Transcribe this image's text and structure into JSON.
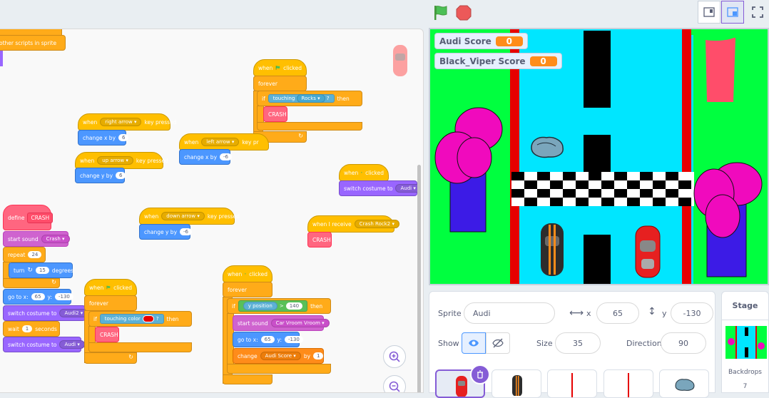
{
  "toolbar": {
    "green_flag_icon": "green-flag-icon",
    "stop_icon": "stop-icon",
    "small_stage_icon": "small-stage-icon",
    "normal_stage_icon": "normal-stage-icon",
    "fullscreen_icon": "fullscreen-icon"
  },
  "code": {
    "top_block": "other scripts in sprite",
    "s1": {
      "hat": "when",
      "hat2": "clicked",
      "forever": "forever",
      "if": "if",
      "touching": "touching",
      "target": "Rocks",
      "q": "?",
      "then": "then",
      "call": "CRASH"
    },
    "s2": {
      "hat": "when",
      "key": "right arrow",
      "pressed": "key pressed",
      "action": "change x by",
      "val": "6"
    },
    "s3": {
      "hat": "when",
      "key": "up arrow",
      "pressed": "key pressed",
      "action": "change y by",
      "val": "6"
    },
    "s4": {
      "hat": "when",
      "key": "left arrow",
      "pressed": "key pr",
      "action": "change x by",
      "val": "-6"
    },
    "s5": {
      "hat": "when",
      "hat2": "clicked",
      "action": "switch costume to",
      "val": "Audi"
    },
    "s6": {
      "hat": "when",
      "key": "down arrow",
      "pressed": "key pressed",
      "action": "change y by",
      "val": "-6"
    },
    "s7": {
      "hat": "when I receive",
      "msg": "Crash Rock2",
      "call": "CRASH"
    },
    "s8": {
      "define": "define",
      "name": "CRASH",
      "sound": "start sound",
      "sound_val": "Crash",
      "repeat": "repeat",
      "repeat_val": "24",
      "turn": "turn",
      "turn_val": "15",
      "degrees": "degrees",
      "goto": "go to x:",
      "x_val": "65",
      "y": "y:",
      "y_val": "-130",
      "costume": "switch costume to",
      "costume_val": "Audi2",
      "wait": "wait",
      "wait_val": "1",
      "seconds": "seconds",
      "costume2": "switch costume to",
      "costume2_val": "Audi"
    },
    "s9": {
      "hat": "when",
      "hat2": "clicked",
      "forever": "forever",
      "if": "if",
      "touching": "touching color",
      "q": "?",
      "then": "then",
      "call": "CRASH"
    },
    "s10": {
      "hat": "when",
      "hat2": "clicked",
      "forever": "forever",
      "if": "if",
      "ypos": "y position",
      "op": ">",
      "op_val": "140",
      "then": "then",
      "sound": "start sound",
      "sound_val": "Car Vroom Vroom",
      "goto": "go to x:",
      "x_val": "65",
      "y": "y:",
      "y_val": "-130",
      "change": "change",
      "var": "Audi Score",
      "by": "by",
      "by_val": "1"
    },
    "zoom_in_icon": "zoom-in-icon",
    "zoom_out_icon": "zoom-out-icon"
  },
  "stage": {
    "monitors": [
      {
        "label": "Audi Score",
        "value": "0"
      },
      {
        "label": "Black_Viper Score",
        "value": "0"
      }
    ]
  },
  "sprite_info": {
    "sprite_label": "Sprite",
    "sprite_name": "Audi",
    "x_label": "x",
    "x": "65",
    "y_label": "y",
    "y": "-130",
    "show_label": "Show",
    "size_label": "Size",
    "size": "35",
    "direction_label": "Direction",
    "direction": "90"
  },
  "stage_panel": {
    "title": "Stage",
    "backdrops_label": "Backdrops",
    "backdrops_count": "7"
  },
  "colors": {
    "motion": "#4c97ff",
    "events": "#ffbf00",
    "control": "#ffab19",
    "looks": "#9966ff",
    "sound": "#cf63cf",
    "myblocks": "#ff6680",
    "sensing": "#5cb1d6",
    "operators": "#59c059",
    "accent": "#855cd6"
  }
}
